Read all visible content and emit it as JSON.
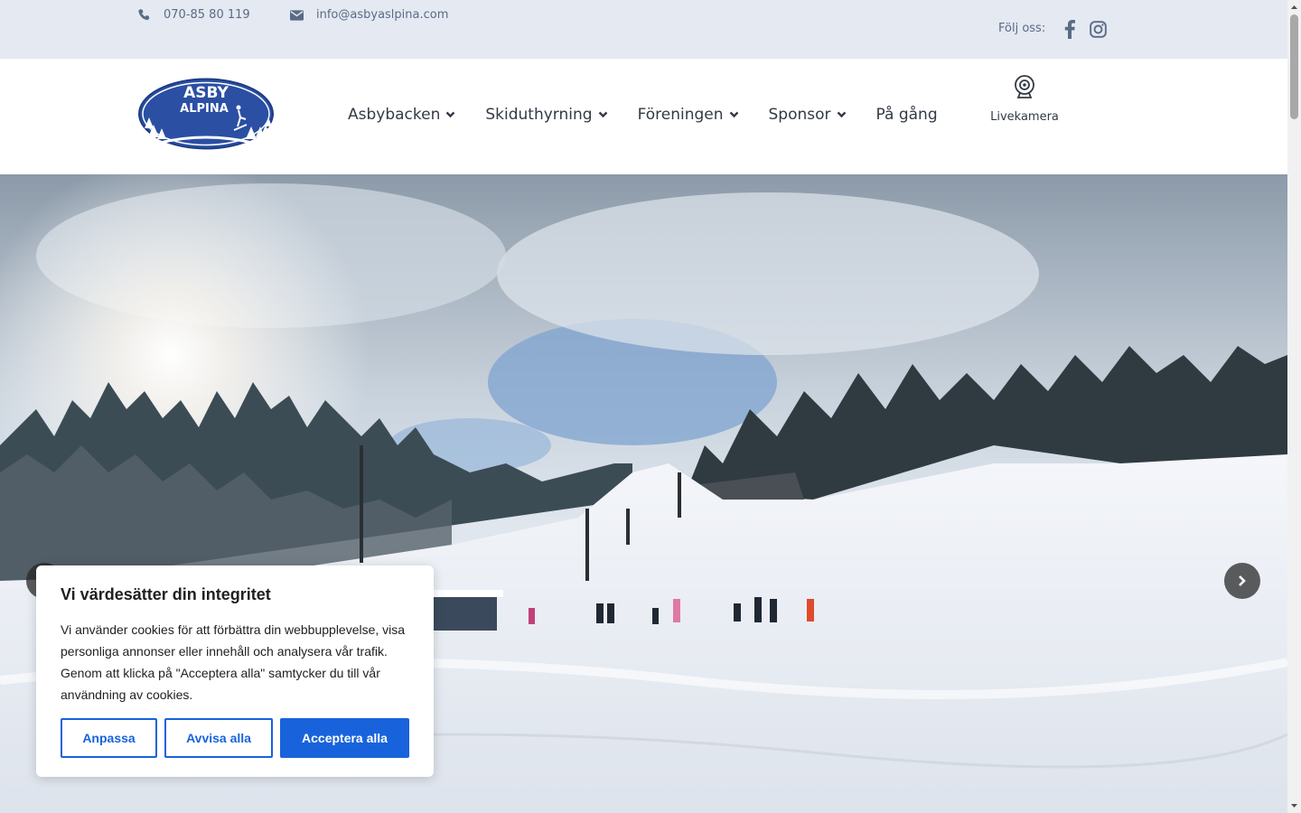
{
  "topbar": {
    "phone": "070-85 80 119",
    "email": "info@asbyaslpina.com",
    "follow_label": "Följ oss:",
    "social_icons": [
      "facebook-icon",
      "instagram-icon"
    ]
  },
  "header": {
    "logo": {
      "line1": "ASBY",
      "line2": "ALPINA"
    },
    "nav": [
      {
        "label": "Asbybacken",
        "has_dropdown": true
      },
      {
        "label": "Skiduthyrning",
        "has_dropdown": true
      },
      {
        "label": "Föreningen",
        "has_dropdown": true
      },
      {
        "label": "Sponsor",
        "has_dropdown": true
      },
      {
        "label": "På gång",
        "has_dropdown": false
      }
    ],
    "livecam_label": "Livekamera"
  },
  "cookie": {
    "title": "Vi värdesätter din integritet",
    "text": "Vi använder cookies för att förbättra din webbupplevelse, visa personliga annonser eller innehåll och analysera vår trafik. Genom att klicka på \"Acceptera alla\" samtycker du till vår användning av cookies.",
    "customize_label": "Anpassa",
    "reject_label": "Avvisa alla",
    "accept_label": "Acceptera alla"
  },
  "colors": {
    "topbar_bg": "#e4e9f2",
    "text_muted": "#5b6b85",
    "nav_text": "#333a45",
    "accent_blue": "#1863dc",
    "logo_blue": "#2a4fa3"
  }
}
